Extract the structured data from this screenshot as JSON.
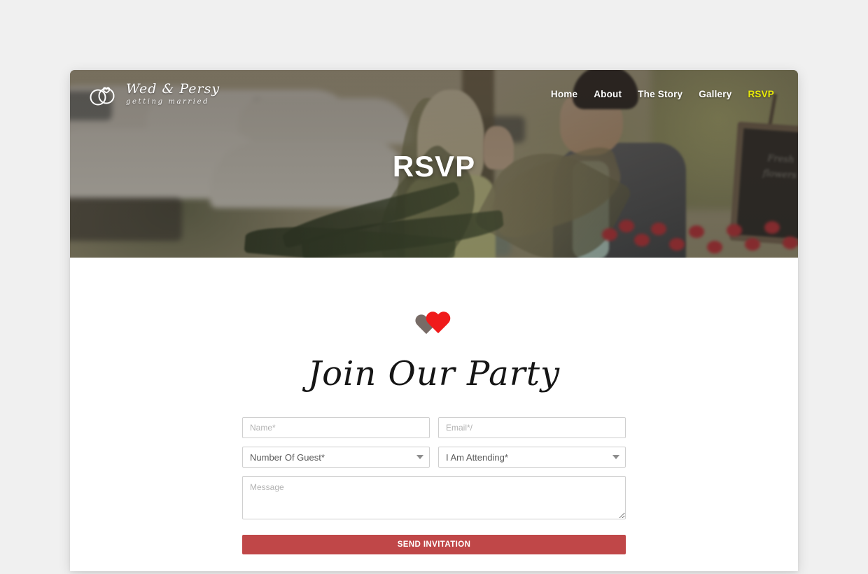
{
  "brand": {
    "logo_icon": "wedding-rings-heart-icon",
    "title": "Wed & Persy",
    "subtitle": "getting married"
  },
  "nav": {
    "items": [
      {
        "label": "Home",
        "active": false
      },
      {
        "label": "About",
        "active": false
      },
      {
        "label": "The Story",
        "active": false
      },
      {
        "label": "Gallery",
        "active": false
      },
      {
        "label": "RSVP",
        "active": true
      }
    ],
    "active_color": "#e9ea08",
    "link_color": "#ffffff"
  },
  "hero": {
    "title": "RSVP",
    "chalkboard_text": "Fresh flowers"
  },
  "section": {
    "hearts_icon": "double-heart-icon",
    "heart_back_color": "#776b66",
    "heart_front_color": "#f01b1b",
    "title": "Join Our Party"
  },
  "form": {
    "name": {
      "placeholder": "Name*",
      "value": ""
    },
    "email": {
      "placeholder": "Email*/",
      "value": ""
    },
    "guests": {
      "label": "Number Of Guest*",
      "icon": "chevron-down-icon"
    },
    "attending": {
      "label": "I Am Attending*",
      "icon": "chevron-down-icon"
    },
    "message": {
      "placeholder": "Message",
      "value": ""
    },
    "submit": {
      "label": "SEND INVITATION",
      "color": "#c04748"
    }
  }
}
